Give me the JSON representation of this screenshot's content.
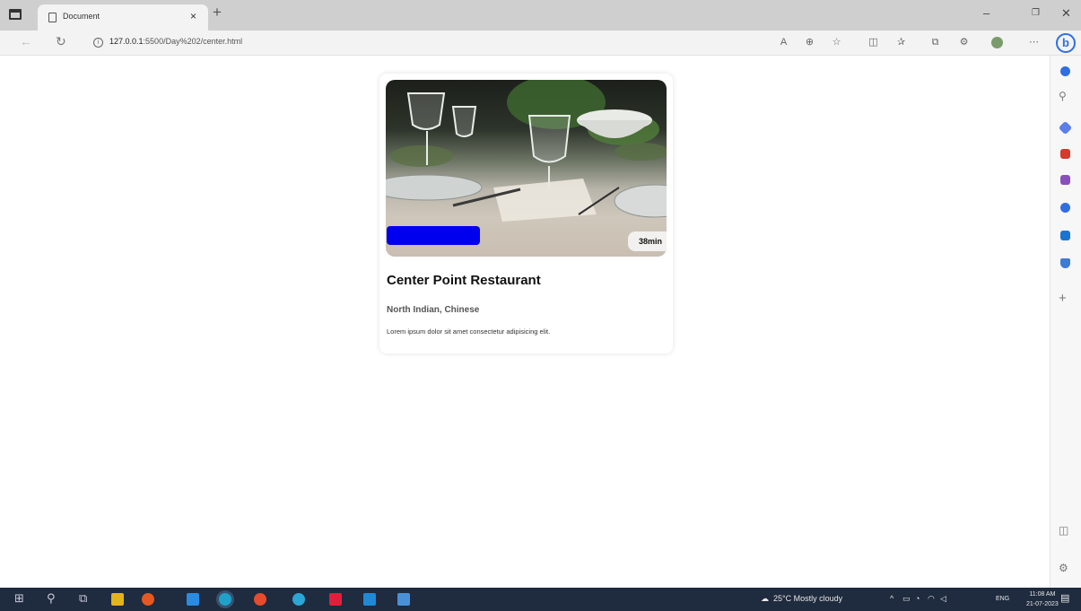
{
  "browser": {
    "tab_title": "Document",
    "tab_close": "×",
    "new_tab": "+",
    "url_host": "127.0.0.1",
    "url_rest": ":5500/Day%202/center.html",
    "window_controls": {
      "minimize": "–",
      "maximize": "❐",
      "close": "✕"
    }
  },
  "card": {
    "badge_label": "",
    "time_label": "38min",
    "title": "Center Point Restaurant",
    "cuisine": "North Indian, Chinese",
    "description": "Lorem ipsum dolor sit amet consectetur adipisicing elit."
  },
  "taskbar": {
    "weather": "25°C  Mostly cloudy",
    "language": "ENG",
    "time": "11:08 AM",
    "date": "21-07-2023"
  },
  "colors": {
    "badge": "#0000ee",
    "edge_bing": "#2f6ee2",
    "taskbar": "#1f2b3e"
  }
}
